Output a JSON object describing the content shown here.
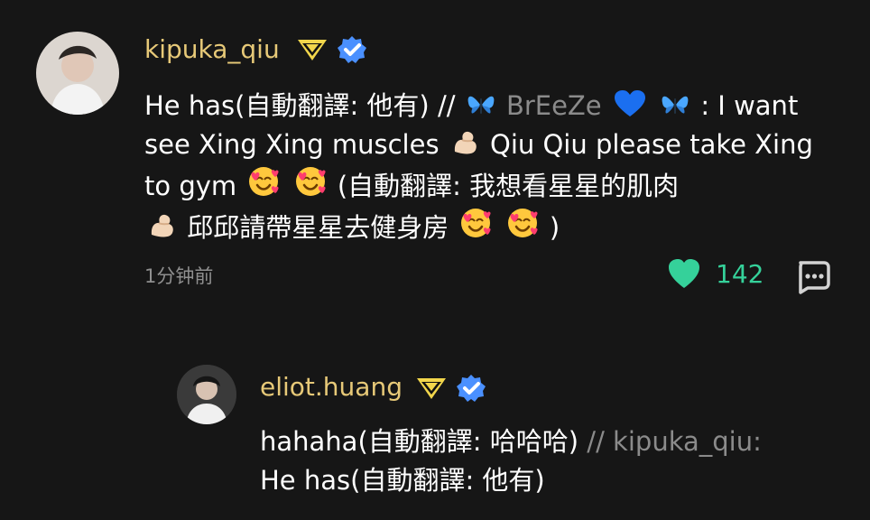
{
  "comment": {
    "username": "kipuka_qiu",
    "text_before_breeze": "He has(自動翻譯: 他有) // ",
    "breeze_name": "BrEeZe",
    "text_after_breeze": ": I want see Xing Xing muscles ",
    "text_qiu": " Qiu Qiu please take Xing to gym ",
    "text_translation": "(自動翻譯: 我想看星星的肌肉",
    "text_translation_2": " 邱邱請帶星星去健身房 ",
    "text_close": ")",
    "timestamp": "1分钟前",
    "likes": "142"
  },
  "reply": {
    "username": "eliot.huang",
    "text_main": "hahaha(自動翻譯: 哈哈哈) ",
    "text_quote": "// kipuka_qiu:",
    "text_second_line": "He has(自動翻譯: 他有)"
  },
  "colors": {
    "background": "#161616",
    "username": "#e7c978",
    "timestamp": "#8f8f8f",
    "like": "#35d19a",
    "muted": "#8b8b8b",
    "verified": "#4a90ff"
  },
  "icons": {
    "badge": "vip-diamond-icon",
    "verified": "verified-check-icon",
    "like": "heart-icon",
    "reply": "comment-bubble-icon",
    "butterfly": "butterfly-emoji-icon",
    "blue_heart": "blue-heart-emoji-icon",
    "muscle": "flexed-biceps-emoji-icon",
    "hearts_face": "smiling-face-with-hearts-emoji-icon"
  }
}
